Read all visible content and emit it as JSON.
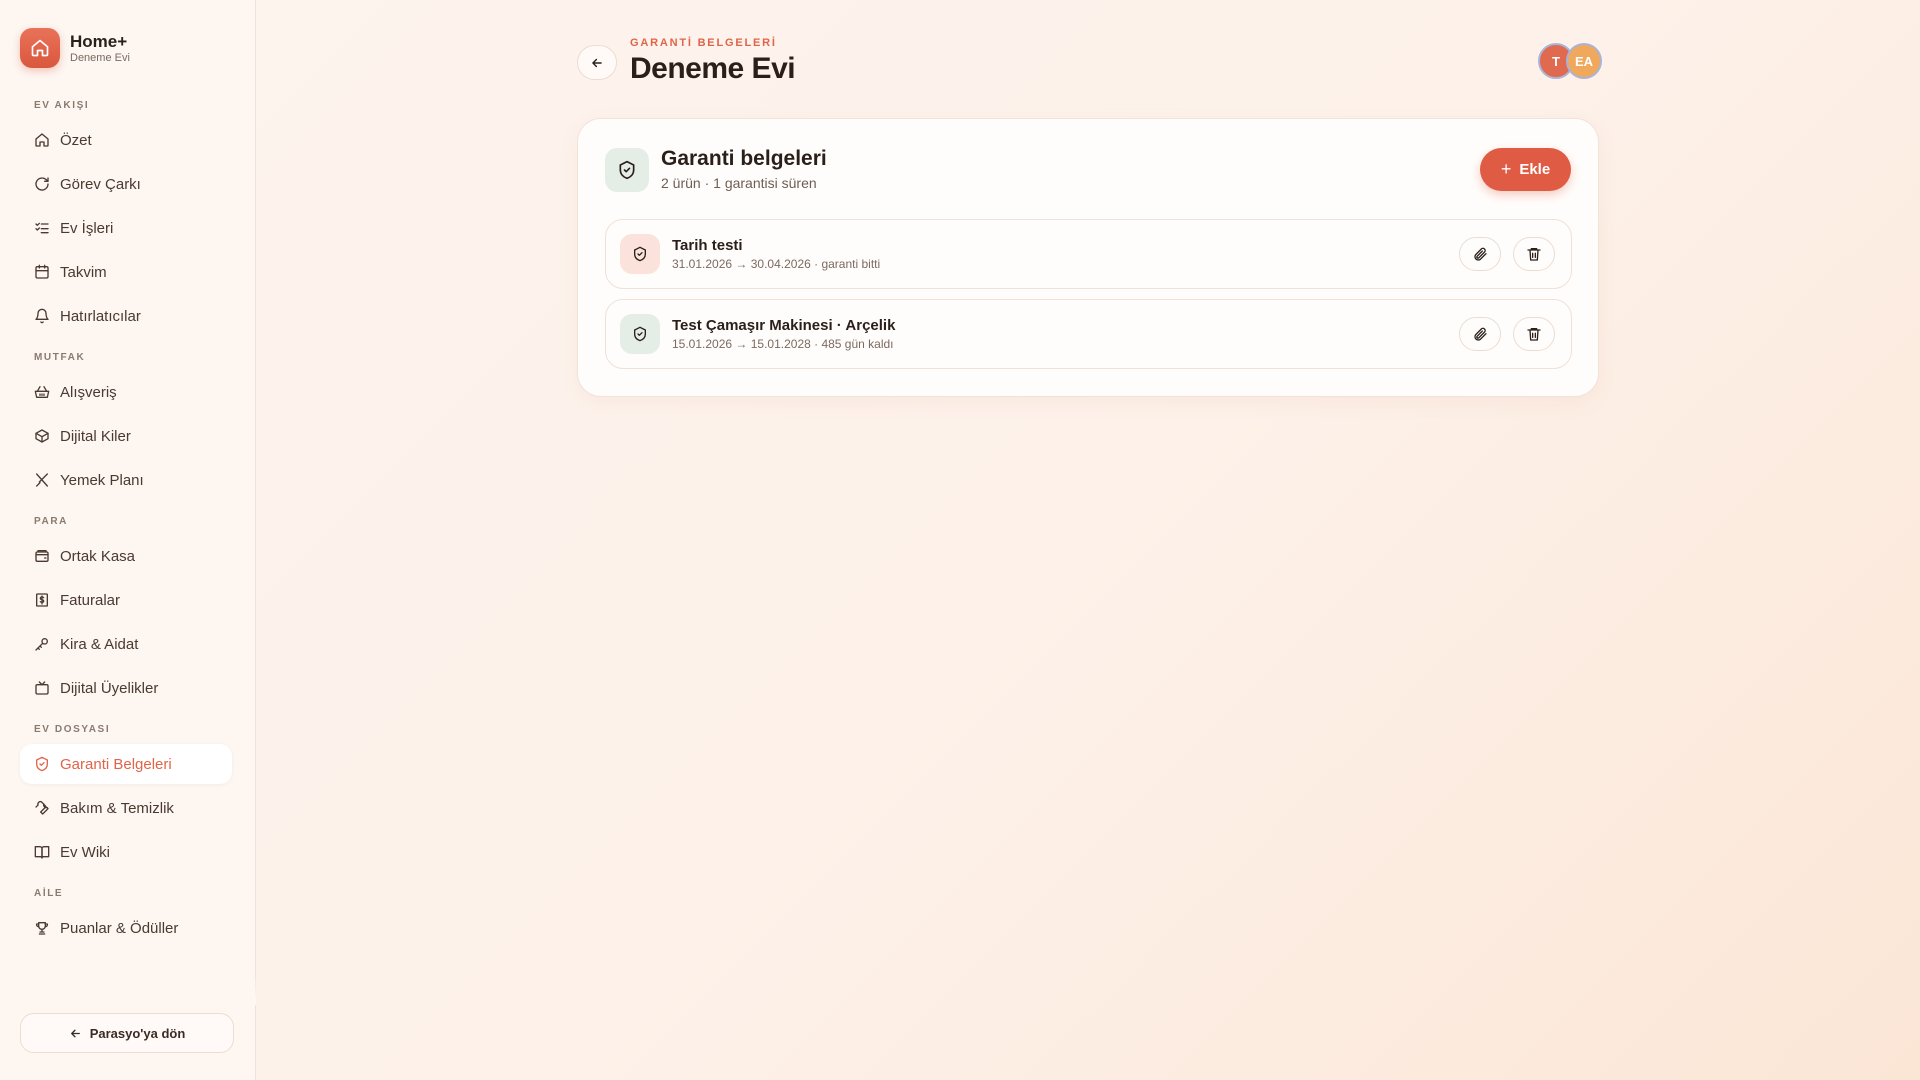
{
  "app": {
    "name": "Home+",
    "household": "Deneme Evi"
  },
  "sidebar": {
    "groups": [
      {
        "title": "EV AKIŞI",
        "items": [
          {
            "label": "Özet",
            "icon": "home-icon"
          },
          {
            "label": "Görev Çarkı",
            "icon": "refresh-icon"
          },
          {
            "label": "Ev İşleri",
            "icon": "list-check-icon"
          },
          {
            "label": "Takvim",
            "icon": "calendar-icon"
          },
          {
            "label": "Hatırlatıcılar",
            "icon": "bell-icon"
          }
        ]
      },
      {
        "title": "MUTFAK",
        "items": [
          {
            "label": "Alışveriş",
            "icon": "basket-icon"
          },
          {
            "label": "Dijital Kiler",
            "icon": "box-icon"
          },
          {
            "label": "Yemek Planı",
            "icon": "utensils-icon"
          }
        ]
      },
      {
        "title": "PARA",
        "items": [
          {
            "label": "Ortak Kasa",
            "icon": "wallet-icon"
          },
          {
            "label": "Faturalar",
            "icon": "receipt-icon"
          },
          {
            "label": "Kira & Aidat",
            "icon": "key-icon"
          },
          {
            "label": "Dijital Üyelikler",
            "icon": "tv-icon"
          }
        ]
      },
      {
        "title": "EV DOSYASI",
        "items": [
          {
            "label": "Garanti Belgeleri",
            "icon": "shield-icon",
            "active": true
          },
          {
            "label": "Bakım & Temizlik",
            "icon": "wrench-icon"
          },
          {
            "label": "Ev Wiki",
            "icon": "book-icon"
          }
        ]
      },
      {
        "title": "AİLE",
        "items": [
          {
            "label": "Puanlar & Ödüller",
            "icon": "trophy-icon"
          }
        ]
      }
    ],
    "back_label": "Parasyo'ya dön"
  },
  "header": {
    "eyebrow": "GARANTİ BELGELERİ",
    "title": "Deneme Evi",
    "avatars": [
      "T",
      "EA"
    ]
  },
  "card": {
    "title": "Garanti belgeleri",
    "subtitle": "2 ürün · 1 garantisi süren",
    "add_label": "Ekle",
    "items": [
      {
        "name": "Tarih testi",
        "meta": "31.01.2026 → 30.04.2026 · garanti bitti",
        "status": "expired"
      },
      {
        "name": "Test Çamaşır Makinesi · Arçelik",
        "meta": "15.01.2026 → 15.01.2028 · 485 gün kaldı",
        "status": "active"
      }
    ]
  },
  "colors": {
    "accent": "#df5b43",
    "active_green": "#e4ede6",
    "expired_red": "#fbe3dc"
  }
}
